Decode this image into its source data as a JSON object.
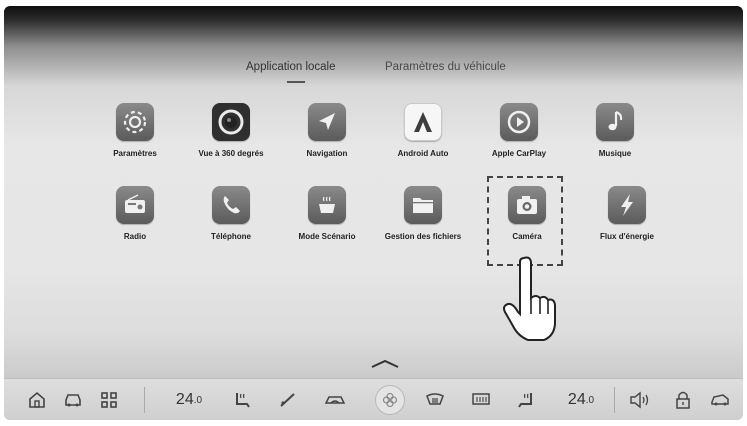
{
  "tabs": [
    {
      "label": "Application locale",
      "active": true
    },
    {
      "label": "Paramètres du véhicule",
      "active": false
    }
  ],
  "apps": {
    "settings": {
      "label": "Paramètres",
      "icon": "gear-icon"
    },
    "view360": {
      "label": "Vue à 360 degrés",
      "icon": "camera-360-icon"
    },
    "navigation": {
      "label": "Navigation",
      "icon": "navigation-arrow-icon"
    },
    "android_auto": {
      "label": "Android Auto",
      "icon": "android-auto-icon"
    },
    "carplay": {
      "label": "Apple CarPlay",
      "icon": "carplay-icon"
    },
    "music": {
      "label": "Musique",
      "icon": "music-note-icon"
    },
    "radio": {
      "label": "Radio",
      "icon": "radio-icon"
    },
    "phone": {
      "label": "Téléphone",
      "icon": "phone-icon"
    },
    "scenario": {
      "label": "Mode Scénario",
      "icon": "coffee-cup-icon"
    },
    "files": {
      "label": "Gestion des fichiers",
      "icon": "folder-icon"
    },
    "camera": {
      "label": "Caméra",
      "icon": "camera-icon",
      "selected": true
    },
    "energy": {
      "label": "Flux d'énergie",
      "icon": "lightning-icon"
    }
  },
  "bottom_bar": {
    "left_temp": "24.0",
    "right_temp": "24.0",
    "left_temp_main": "24",
    "left_temp_dec": ".0",
    "right_temp_main": "24",
    "right_temp_dec": ".0"
  },
  "colors": {
    "icon_gray": "#6f6f6f",
    "bar_bg": "#d6d6d6",
    "text": "#222222"
  }
}
